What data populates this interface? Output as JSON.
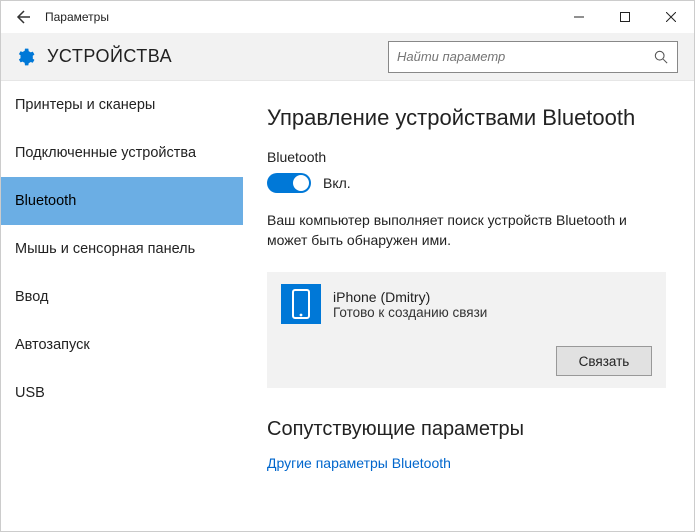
{
  "titlebar": {
    "title": "Параметры"
  },
  "header": {
    "section": "УСТРОЙСТВА",
    "search_placeholder": "Найти параметр"
  },
  "sidebar": {
    "items": [
      {
        "label": "Принтеры и сканеры"
      },
      {
        "label": "Подключенные устройства"
      },
      {
        "label": "Bluetooth"
      },
      {
        "label": "Мышь и сенсорная панель"
      },
      {
        "label": "Ввод"
      },
      {
        "label": "Автозапуск"
      },
      {
        "label": "USB"
      }
    ],
    "active_index": 2
  },
  "main": {
    "heading": "Управление устройствами Bluetooth",
    "toggle_group_label": "Bluetooth",
    "toggle_state_label": "Вкл.",
    "toggle_on": true,
    "description": "Ваш компьютер выполняет поиск устройств Bluetooth и может быть обнаружен ими.",
    "device": {
      "name": "iPhone (Dmitry)",
      "status": "Готово к созданию связи",
      "pair_label": "Связать"
    },
    "related_heading": "Сопутствующие параметры",
    "related_link": "Другие параметры Bluetooth"
  }
}
